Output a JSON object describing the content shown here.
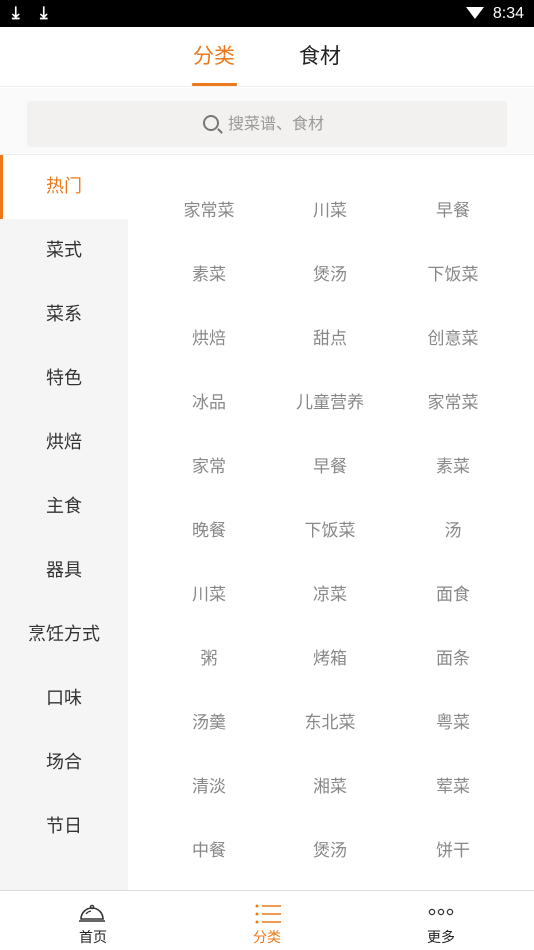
{
  "status_bar": {
    "download_icon_1": "download-arrow-icon",
    "download_icon_2": "download-arrow-icon",
    "wifi_icon": "wifi-icon",
    "time": "8:34"
  },
  "tabs": [
    {
      "label": "分类",
      "active": true
    },
    {
      "label": "食材",
      "active": false
    }
  ],
  "search": {
    "placeholder": "搜菜谱、食材",
    "icon": "search-icon"
  },
  "sidebar": {
    "items": [
      {
        "label": "热门",
        "active": true
      },
      {
        "label": "菜式",
        "active": false
      },
      {
        "label": "菜系",
        "active": false
      },
      {
        "label": "特色",
        "active": false
      },
      {
        "label": "烘焙",
        "active": false
      },
      {
        "label": "主食",
        "active": false
      },
      {
        "label": "器具",
        "active": false
      },
      {
        "label": "烹饪方式",
        "active": false
      },
      {
        "label": "口味",
        "active": false
      },
      {
        "label": "场合",
        "active": false
      },
      {
        "label": "节日",
        "active": false
      }
    ]
  },
  "grid": {
    "rows": [
      [
        "家常菜",
        "川菜",
        "早餐"
      ],
      [
        "素菜",
        "煲汤",
        "下饭菜"
      ],
      [
        "烘焙",
        "甜点",
        "创意菜"
      ],
      [
        "冰品",
        "儿童营养",
        "家常菜"
      ],
      [
        "家常",
        "早餐",
        "素菜"
      ],
      [
        "晚餐",
        "下饭菜",
        "汤"
      ],
      [
        "川菜",
        "凉菜",
        "面食"
      ],
      [
        "粥",
        "烤箱",
        "面条"
      ],
      [
        "汤羹",
        "东北菜",
        "粤菜"
      ],
      [
        "清淡",
        "湘菜",
        "荤菜"
      ],
      [
        "中餐",
        "煲汤",
        "饼干"
      ]
    ]
  },
  "bottom_nav": {
    "items": [
      {
        "label": "首页",
        "icon": "home-cloche-icon",
        "active": false
      },
      {
        "label": "分类",
        "icon": "list-icon",
        "active": true
      },
      {
        "label": "更多",
        "icon": "more-dots-icon",
        "active": false
      }
    ]
  },
  "colors": {
    "accent": "#ec7a1c",
    "sidebar_bg": "#f5f5f5",
    "search_bg": "#f2f1ef",
    "grid_text": "#888888"
  }
}
